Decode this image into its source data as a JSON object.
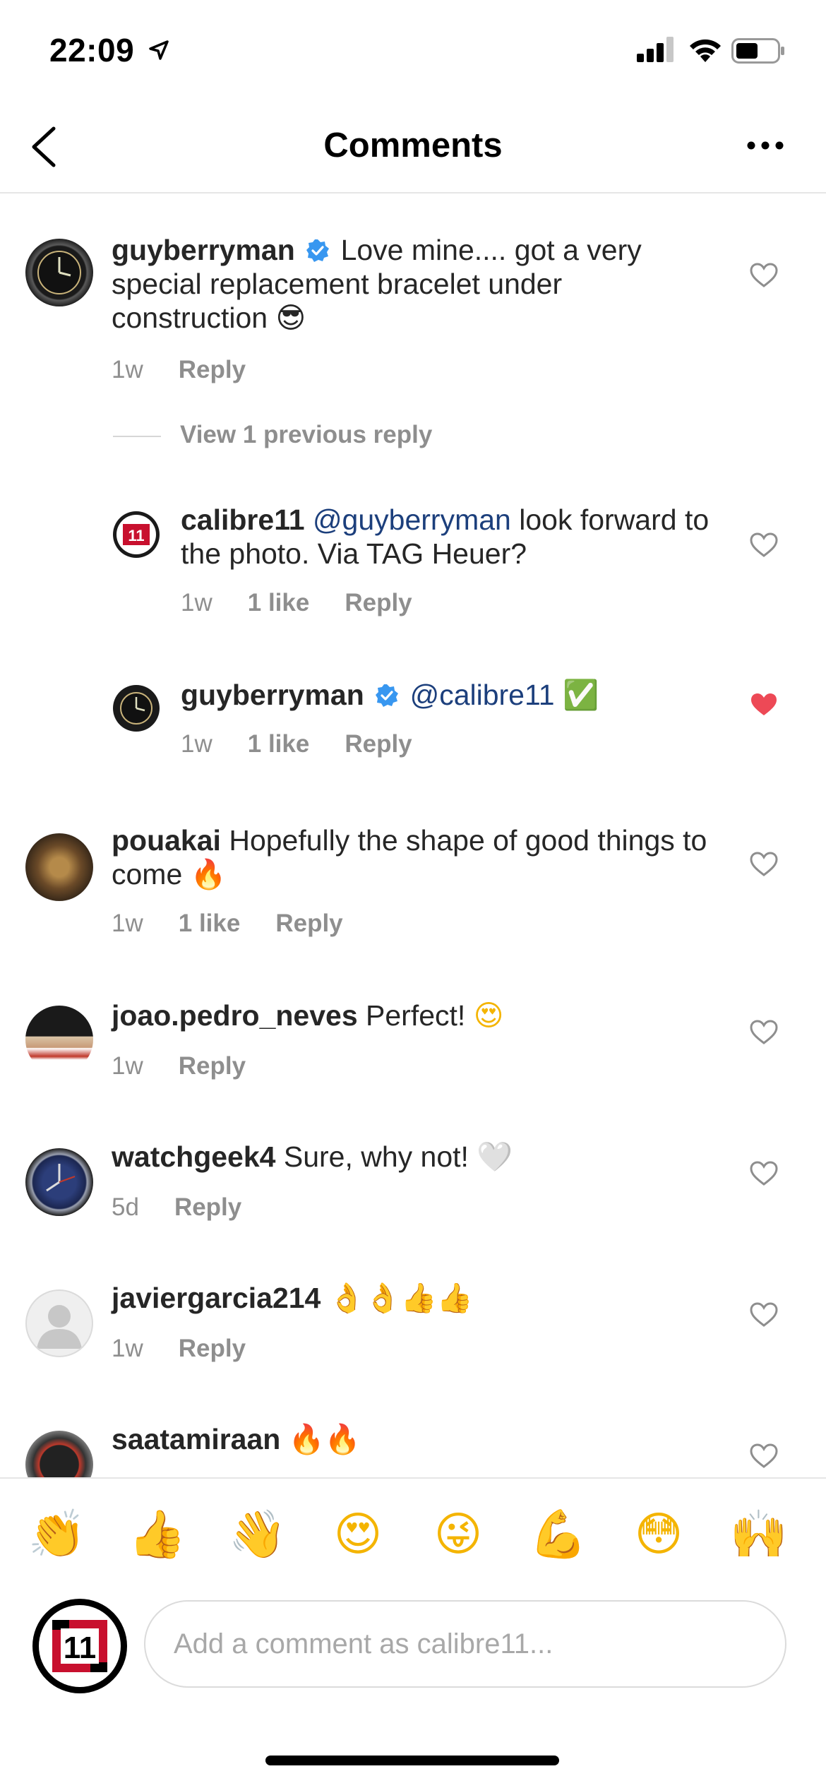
{
  "status": {
    "time": "22:09"
  },
  "nav": {
    "title": "Comments"
  },
  "comments": [
    {
      "user": "guyberryman",
      "verified": true,
      "text": "Love mine.... got a very special replacement bracelet under construction",
      "emoji": "😎",
      "time": "1w",
      "reply": "Reply",
      "liked": false
    },
    {
      "user": "calibre11",
      "mention": "@guyberryman",
      "text": "look forward to the photo. Via TAG Heuer?",
      "time": "1w",
      "likes": "1 like",
      "reply": "Reply",
      "liked": false
    },
    {
      "user": "guyberryman",
      "verified": true,
      "mention": "@calibre11",
      "emoji": "✅",
      "time": "1w",
      "likes": "1 like",
      "reply": "Reply",
      "liked": true
    },
    {
      "user": "pouakai",
      "text": "Hopefully the shape of good things to come",
      "emoji": "🔥",
      "time": "1w",
      "likes": "1 like",
      "reply": "Reply",
      "liked": false
    },
    {
      "user": "joao.pedro_neves",
      "text": "Perfect!",
      "emoji": "😍",
      "time": "1w",
      "reply": "Reply",
      "liked": false
    },
    {
      "user": "watchgeek4",
      "text": "Sure, why not!",
      "emoji": "🤍",
      "time": "5d",
      "reply": "Reply",
      "liked": false
    },
    {
      "user": "javiergarcia214",
      "emoji": "👌👌👍👍",
      "time": "1w",
      "reply": "Reply",
      "liked": false
    },
    {
      "user": "saatamiraan",
      "emoji": "🔥🔥",
      "liked": false
    }
  ],
  "view_previous": "View 1 previous reply",
  "emoji_bar": [
    "👏",
    "👍",
    "👋",
    "😍",
    "😜",
    "💪",
    "😳",
    "🙌"
  ],
  "composer": {
    "placeholder": "Add a comment as calibre11..."
  },
  "colors": {
    "like_red": "#ed4956",
    "verified_blue": "#3897f0",
    "mention_blue": "#1c3f7c"
  }
}
